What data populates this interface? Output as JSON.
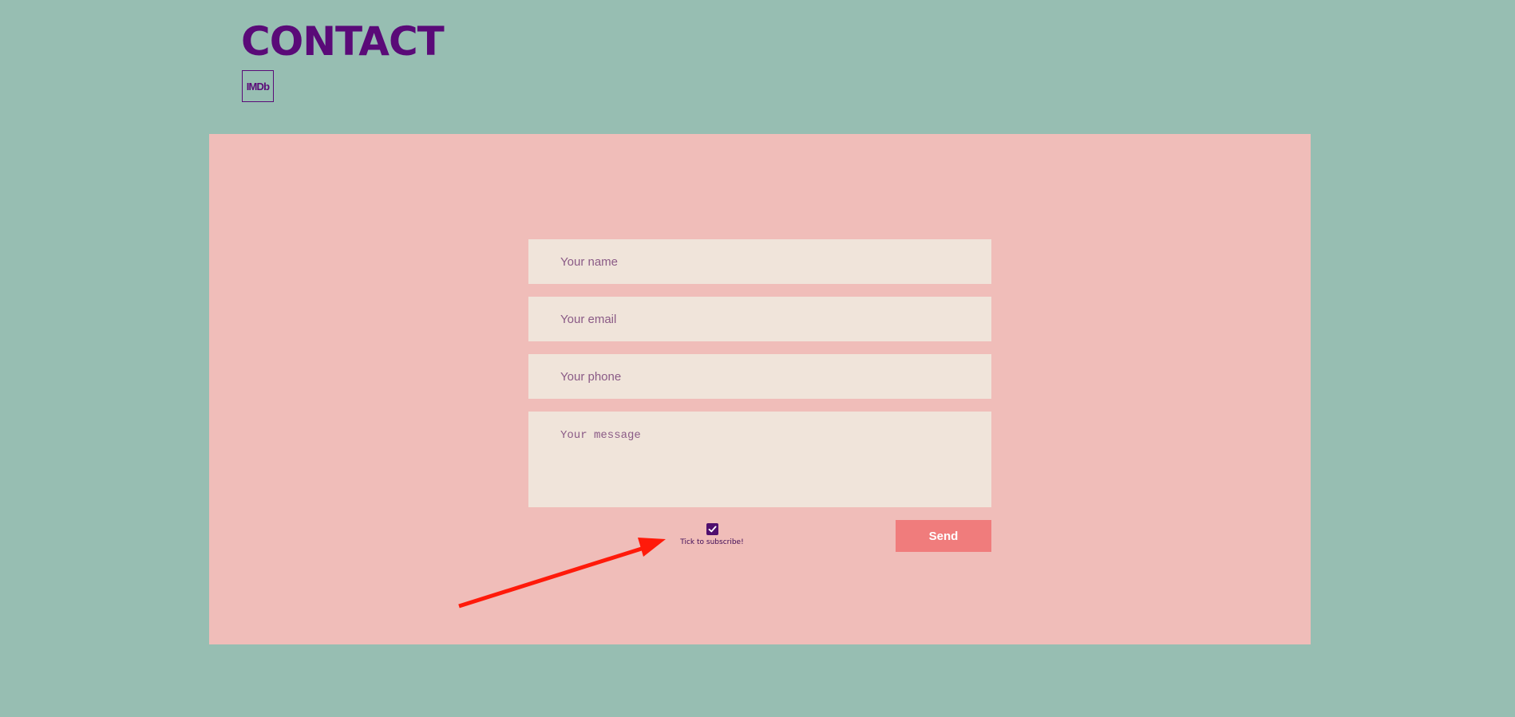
{
  "header": {
    "title": "CONTACT",
    "imdb_link_label": "IMDb"
  },
  "form": {
    "name_placeholder": "Your name",
    "email_placeholder": "Your email",
    "phone_placeholder": "Your phone",
    "message_placeholder": "Your message",
    "subscribe_label": "Tick to subscribe!",
    "subscribe_checked": true,
    "send_label": "Send"
  },
  "icons": {
    "checkmark": "check-icon",
    "annotation": "red-arrow-icon"
  },
  "colors": {
    "page_background": "#97beb2",
    "panel_background": "#f0bdb9",
    "field_background": "#f0e4da",
    "accent_purple": "#5a0a78",
    "send_button": "#f07c7c",
    "annotation_arrow": "#ff1a0a"
  }
}
